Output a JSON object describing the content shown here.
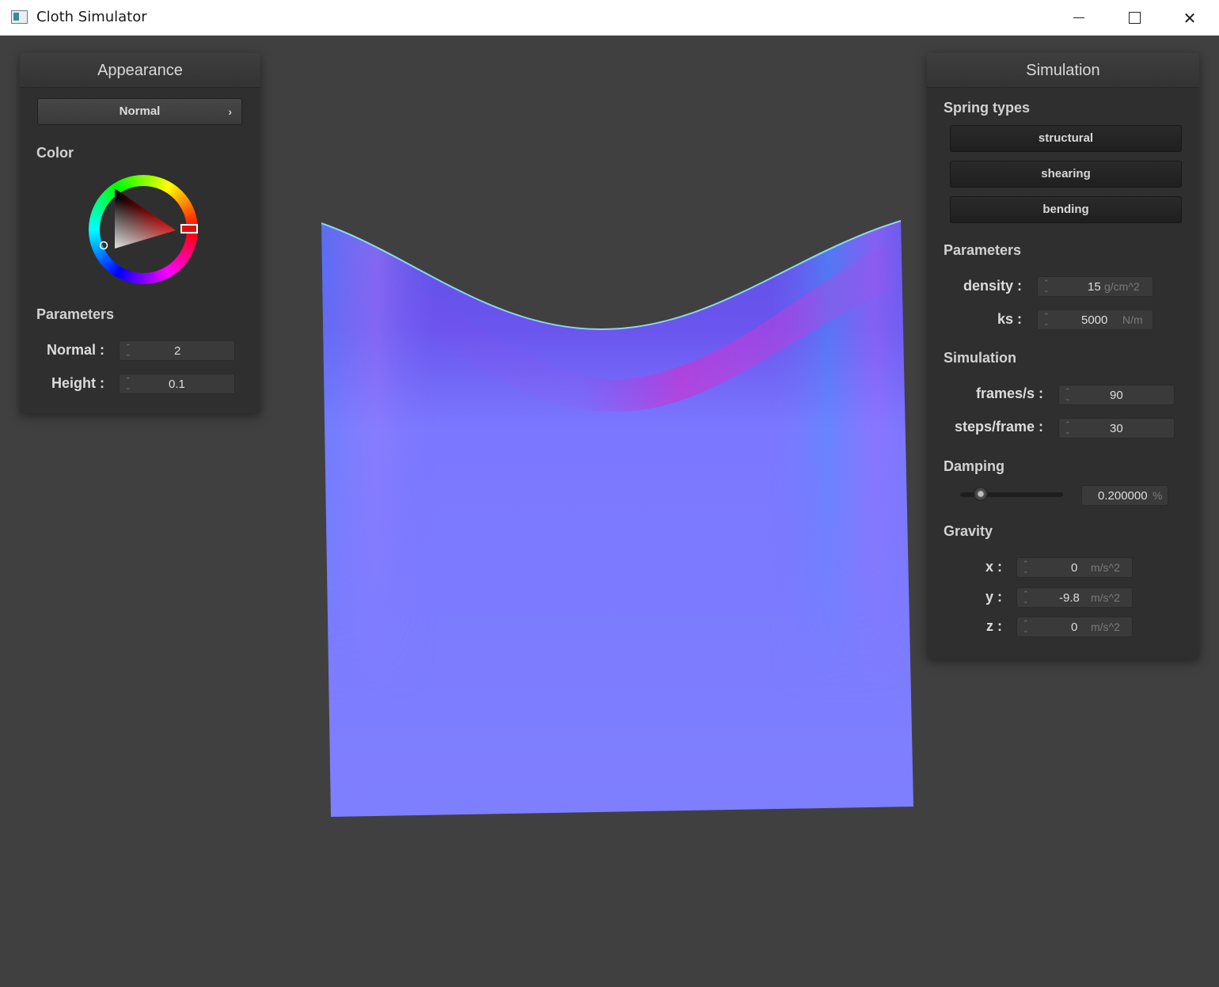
{
  "window": {
    "title": "Cloth Simulator"
  },
  "appearance": {
    "title": "Appearance",
    "shader_selected": "Normal",
    "color_label": "Color",
    "params_label": "Parameters",
    "normal_label": "Normal :",
    "normal_value": "2",
    "height_label": "Height :",
    "height_value": "0.1",
    "selected_color": "#e01010"
  },
  "simulation": {
    "title": "Simulation",
    "spring_types_label": "Spring types",
    "spring_types": [
      "structural",
      "shearing",
      "bending"
    ],
    "params_label": "Parameters",
    "density_label": "density :",
    "density_value": "15",
    "density_unit": "g/cm^2",
    "ks_label": "ks :",
    "ks_value": "5000",
    "ks_unit": "N/m",
    "sim_label": "Simulation",
    "fps_label": "frames/s :",
    "fps_value": "90",
    "steps_label": "steps/frame :",
    "steps_value": "30",
    "damping_label": "Damping",
    "damping_value": "0.200000",
    "damping_unit": "%",
    "damping_slider_fraction": 0.2,
    "gravity_label": "Gravity",
    "gx_label": "x :",
    "gx_value": "0",
    "gy_label": "y :",
    "gy_value": "-9.8",
    "gz_label": "z :",
    "gz_value": "0",
    "gravity_unit": "m/s^2"
  }
}
